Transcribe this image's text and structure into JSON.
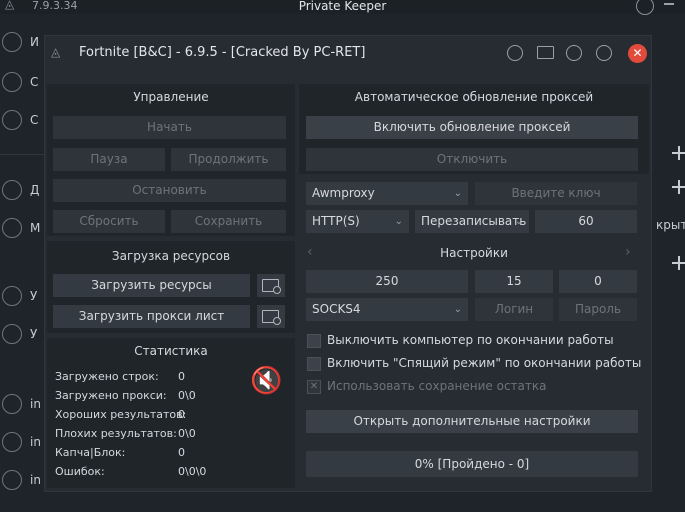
{
  "bg": {
    "version": "7.9.3.34",
    "app_title": "Private Keeper",
    "side_labels": [
      "И",
      "С",
      "С",
      "Д",
      "М",
      "У",
      "У",
      "in",
      "in",
      "in"
    ],
    "right_label": "крыть"
  },
  "window": {
    "title": "Fortnite [B&C] - 6.9.5 - [Cracked By PC-RET]",
    "close_glyph": "✕"
  },
  "control": {
    "title": "Управление",
    "start": "Начать",
    "pause": "Пауза",
    "resume": "Продолжить",
    "stop": "Остановить",
    "reset": "Сбросить",
    "save_rest": "Сохранить остаток"
  },
  "resources": {
    "title": "Загрузка ресурсов",
    "load_resources": "Загрузить ресурсы",
    "load_proxy": "Загрузить прокси лист"
  },
  "stats": {
    "title": "Статистика",
    "rows": [
      {
        "label": "Загружено строк:",
        "value": "0"
      },
      {
        "label": "Загружено прокси:",
        "value": "0\\0"
      },
      {
        "label": "Хороших результатов:",
        "value": "0"
      },
      {
        "label": "Плохих результатов:",
        "value": "0\\0"
      },
      {
        "label": "Капча|Блок:",
        "value": "0"
      },
      {
        "label": "Ошибок:",
        "value": "0\\0\\0"
      }
    ]
  },
  "proxy": {
    "title": "Автоматическое обновление проксей",
    "enable": "Включить обновление проксей",
    "disable": "Отключить",
    "source": "Awmproxy",
    "key_placeholder": "Введите ключ",
    "protocol": "HTTP(S)",
    "mode": "Перезаписывать",
    "interval": "60"
  },
  "settings": {
    "title": "Настройки",
    "v1": "250",
    "v2": "15",
    "v3": "0",
    "socks": "SOCKS4",
    "login": "Логин",
    "password": "Пароль",
    "cb1": "Выключить компьютер по окончании работы",
    "cb2": "Включить \"Спящий режим\" по окончании работы",
    "cb3": "Использовать сохранение остатка",
    "cb3_mark": "✕",
    "more": "Открыть дополнительные настройки",
    "progress": "0% [Пройдено - 0]"
  }
}
